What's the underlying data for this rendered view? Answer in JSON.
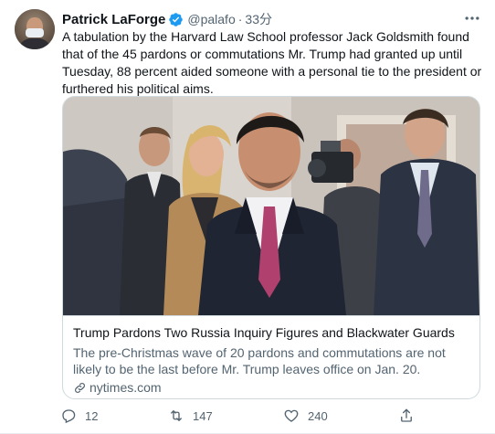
{
  "tweet": {
    "author_name": "Patrick LaForge",
    "handle": "@palafo",
    "separator": "·",
    "time": "33分",
    "text": "A tabulation by the Harvard Law School professor Jack Goldsmith found that of the 45 pardons or commutations Mr. Trump had granted up until Tuesday, 88 percent aided someone with a personal tie to the president or furthered his political aims."
  },
  "card": {
    "title": "Trump Pardons Two Russia Inquiry Figures and Blackwater Guards",
    "description": "The pre-Christmas wave of 20 pardons and commutations are not likely to be the last before Mr. Trump leaves office on Jan. 20.",
    "domain": "nytimes.com"
  },
  "actions": {
    "replies": "12",
    "retweets": "147",
    "likes": "240"
  },
  "colors": {
    "verified_blue": "#1d9bf0",
    "secondary_text": "#536471",
    "border": "#cfd9de"
  }
}
